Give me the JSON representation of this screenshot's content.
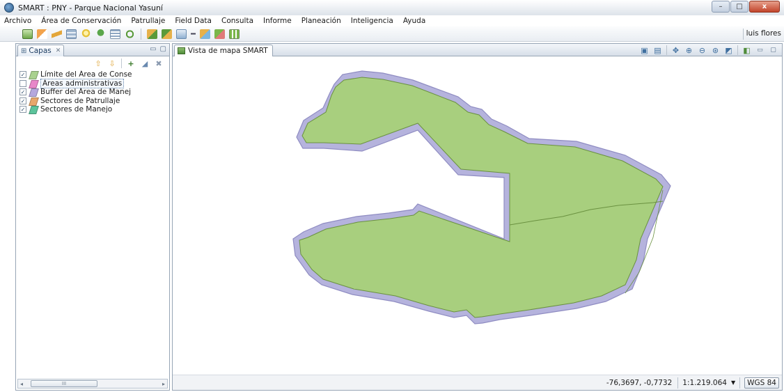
{
  "window": {
    "title": "SMART : PNY - Parque Nacional Yasuní",
    "controls": {
      "minimize": "–",
      "maximize": "□",
      "close": "x"
    }
  },
  "menu": [
    "Archivo",
    "Área de Conservación",
    "Patrullaje",
    "Field Data",
    "Consulta",
    "Informe",
    "Planeación",
    "Inteligencia",
    "Ayuda"
  ],
  "toolbar": {
    "user": "luis flores",
    "icons": [
      "map-icon",
      "flag-icon",
      "lightning-icon",
      "table-icon",
      "bulb-icon",
      "tree-icon",
      "list-icon",
      "sync-icon",
      "patrol-add-icon",
      "patrol-edit-icon",
      "patrol-query-icon",
      "dropdown-icon",
      "plan-icon",
      "plan-edit-icon",
      "report-icon"
    ]
  },
  "layers_panel": {
    "tab_label": "Capas",
    "tab_glyph": "⊞",
    "tab_close": "✕",
    "tools": {
      "up": "⇧",
      "down": "⇩",
      "add": "+",
      "style": "◢",
      "remove": "✖"
    },
    "layers": [
      {
        "label": "Límite del Área de Conse",
        "checked": true,
        "color": "#a9d18e"
      },
      {
        "label": "Áreas administrativas",
        "checked": false,
        "color": "#e887c9",
        "selected": true
      },
      {
        "label": "Buffer del Área de Manej",
        "checked": true,
        "color": "#b5a8de"
      },
      {
        "label": "Sectores de Patrullaje",
        "checked": true,
        "color": "#e8a76b"
      },
      {
        "label": "Sectores de Manejo",
        "checked": true,
        "color": "#5cc39b"
      }
    ],
    "scroll_thumb": "III",
    "scroll_left": "◂",
    "scroll_right": "▸"
  },
  "map_view": {
    "tab_label": "Vista de mapa SMART",
    "colors": {
      "area_fill": "#a8cf7e",
      "area_stroke": "#6a9140",
      "buffer": "#b5b3dd",
      "buffer_stroke": "#8f8cc2"
    },
    "status": {
      "coords": "-76,3697, -0,7732",
      "scale": "1:1.219.064",
      "scale_arrow": "▼",
      "crs": "WGS 84"
    }
  }
}
